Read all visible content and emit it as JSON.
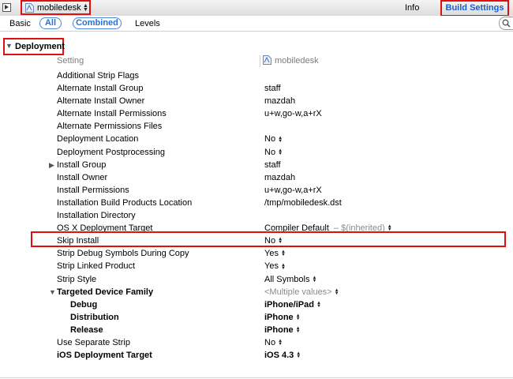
{
  "toolbar": {
    "target": "mobiledesk",
    "tabs": [
      {
        "label": "Info"
      },
      {
        "label": "Build Settings"
      }
    ]
  },
  "filter": {
    "basic": "Basic",
    "all": "All",
    "combined": "Combined",
    "levels": "Levels"
  },
  "section": {
    "title": "Deployment",
    "col_setting": "Setting",
    "col_target": "mobiledesk"
  },
  "rows": [
    {
      "name": "Additional Strip Flags",
      "value": ""
    },
    {
      "name": "Alternate Install Group",
      "value": "staff"
    },
    {
      "name": "Alternate Install Owner",
      "value": "mazdah"
    },
    {
      "name": "Alternate Install Permissions",
      "value": "u+w,go-w,a+rX"
    },
    {
      "name": "Alternate Permissions Files",
      "value": ""
    },
    {
      "name": "Deployment Location",
      "value": "No"
    },
    {
      "name": "Deployment Postprocessing",
      "value": "No"
    },
    {
      "name": "Install Group",
      "value": "staff"
    },
    {
      "name": "Install Owner",
      "value": "mazdah"
    },
    {
      "name": "Install Permissions",
      "value": "u+w,go-w,a+rX"
    },
    {
      "name": "Installation Build Products Location",
      "value": "/tmp/mobiledesk.dst"
    },
    {
      "name": "Installation Directory",
      "value": ""
    },
    {
      "name": "OS X Deployment Target",
      "value": "Compiler Default",
      "inherited": "–  $(inherited)"
    },
    {
      "name": "Skip Install",
      "value": "No"
    },
    {
      "name": "Strip Debug Symbols During Copy",
      "value": "Yes"
    },
    {
      "name": "Strip Linked Product",
      "value": "Yes"
    },
    {
      "name": "Strip Style",
      "value": "All Symbols"
    },
    {
      "name": "Targeted Device Family",
      "value": "<Multiple values>"
    },
    {
      "name": "Debug",
      "value": "iPhone/iPad"
    },
    {
      "name": "Distribution",
      "value": "iPhone"
    },
    {
      "name": "Release",
      "value": "iPhone"
    },
    {
      "name": "Use Separate Strip",
      "value": "No"
    },
    {
      "name": "iOS Deployment Target",
      "value": "iOS 4.3"
    }
  ],
  "colors": {
    "highlight": "#e01010",
    "accent": "#1a5fd0"
  }
}
